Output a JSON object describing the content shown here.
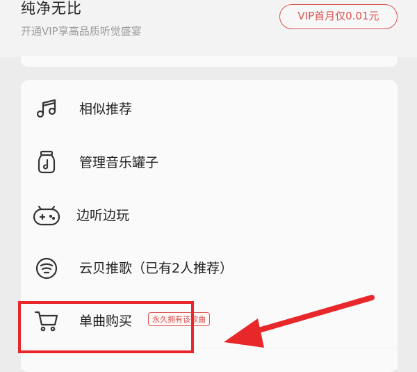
{
  "header": {
    "title": "纯净无比",
    "subtitle": "开通VIP享高品质听觉盛宴",
    "vip_button": "VIP首月仅0.01元"
  },
  "menu": {
    "items": [
      {
        "label": "相似推荐",
        "icon": "music-notes-icon"
      },
      {
        "label": "管理音乐罐子",
        "icon": "music-jar-icon"
      },
      {
        "label": "边听边玩",
        "icon": "gamepad-icon"
      },
      {
        "label": "云贝推歌（已有2人推荐）",
        "icon": "cloud-shell-icon"
      },
      {
        "label": "单曲购买",
        "icon": "cart-icon",
        "badge": "永久拥有该歌曲"
      }
    ]
  },
  "colors": {
    "accent": "#d9534f",
    "annotation": "#e8272a"
  }
}
